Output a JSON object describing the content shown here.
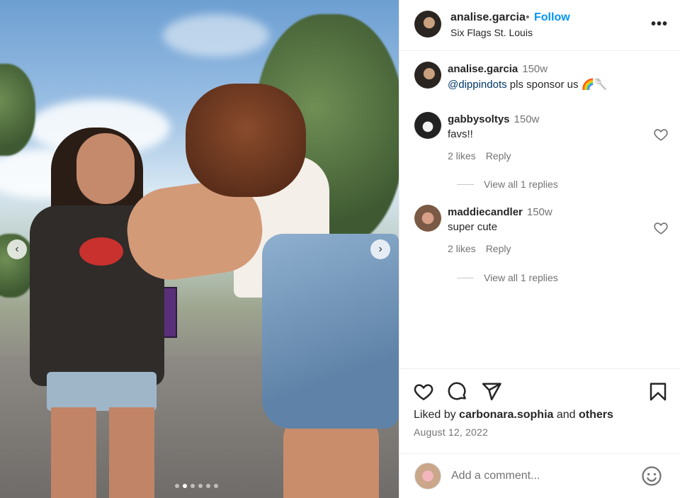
{
  "post": {
    "username": "analise.garcia",
    "separator": "•",
    "follow_label": "Follow",
    "location": "Six Flags St. Louis",
    "more_label": "•••"
  },
  "caption": {
    "username": "analise.garcia",
    "time": "150w",
    "mention": "@dippindots",
    "text": " pls sponsor us 🌈🥄"
  },
  "comments": [
    {
      "username": "gabbysoltys",
      "time": "150w",
      "text": "favs!!",
      "likes": "2 likes",
      "reply_label": "Reply",
      "view_replies": "View all 1 replies"
    },
    {
      "username": "maddiecandler",
      "time": "150w",
      "text": "super cute",
      "likes": "2 likes",
      "reply_label": "Reply",
      "view_replies": "View all 1 replies"
    }
  ],
  "likes_summary": {
    "prefix": "Liked by ",
    "user": "carbonara.sophia",
    "middle": " and ",
    "others": "others"
  },
  "date": "August 12, 2022",
  "composer": {
    "placeholder": "Add a comment..."
  },
  "carousel": {
    "prev_glyph": "‹",
    "next_glyph": "›",
    "slide_count": 6,
    "active_index": 1
  },
  "icons": [
    "more-options-icon",
    "heart-icon",
    "comment-icon",
    "share-icon",
    "bookmark-icon",
    "emoji-icon",
    "chevron-left-icon",
    "chevron-right-icon"
  ],
  "colors": {
    "follow": "#0095f6",
    "mention": "#00376b",
    "secondary_text": "#737373"
  }
}
